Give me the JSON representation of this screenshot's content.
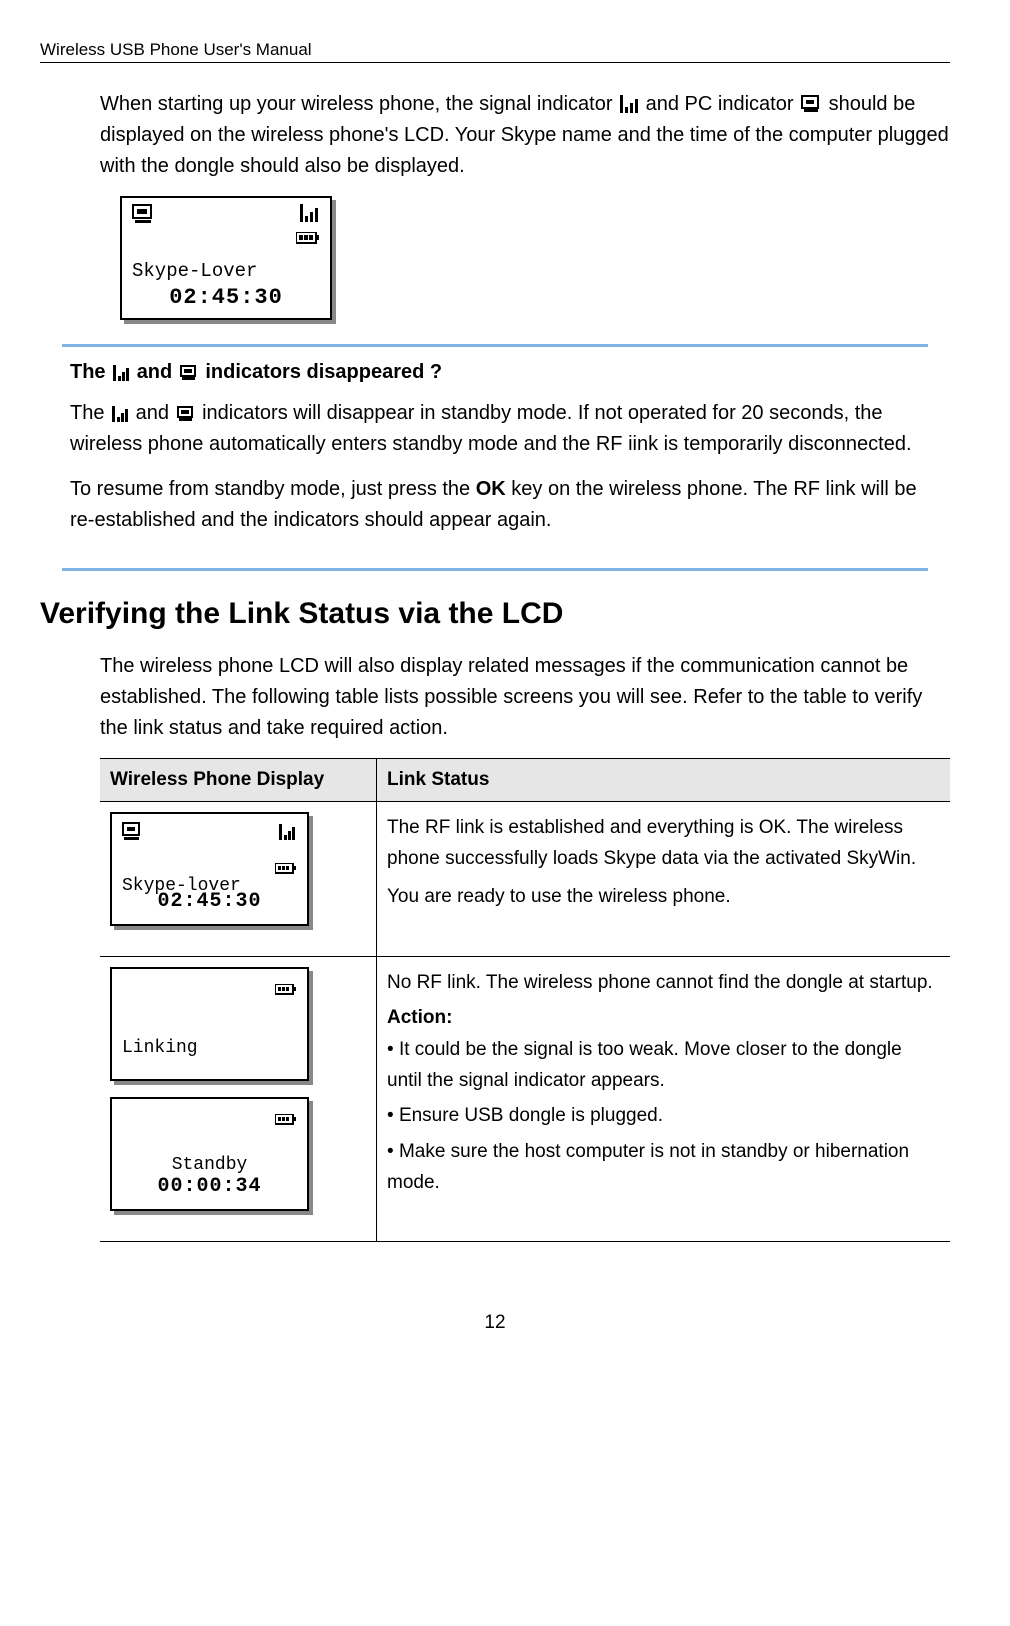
{
  "header": {
    "title": "Wireless USB Phone User's Manual"
  },
  "intro": {
    "part1": "When starting up your wireless phone, the signal indicator ",
    "part2": " and PC indicator ",
    "part3": " should be displayed on the wireless phone's LCD. Your Skype name and the time of the computer plugged with the dongle should also be displayed."
  },
  "lcd_main": {
    "name": "Skype-Lover",
    "time": "02:45:30"
  },
  "info_box": {
    "question_prefix": "The ",
    "question_mid": " and ",
    "question_suffix": " indicators disappeared ?",
    "p1_prefix": "The ",
    "p1_mid": " and ",
    "p1_suffix": " indicators will disappear in standby mode. If not operated for 20 seconds, the wireless phone automatically enters standby mode and the RF iink is temporarily disconnected.",
    "p2_a": "To resume from standby mode, just press the ",
    "p2_ok": "OK",
    "p2_b": " key on the wireless phone. The RF link will be re-established and the indicators should appear again."
  },
  "section_heading": "Verifying the Link Status via the LCD",
  "section_intro": "The wireless phone LCD will also display related messages if the communication cannot be established. The following table lists possible screens you will see. Refer to the table to verify the link status and take required action.",
  "table": {
    "h1": "Wireless Phone Display",
    "h2": "Link Status",
    "row1": {
      "lcd_name": "Skype-lover",
      "lcd_time": "02:45:30",
      "desc1": "The RF link is established and everything is OK. The wireless phone successfully loads Skype data via the activated SkyWin.",
      "desc2": "You are ready to use the wireless phone."
    },
    "row2": {
      "lcd_a_text": "Linking",
      "lcd_b_text": "Standby",
      "lcd_b_time": "00:00:34",
      "desc1": "No RF link. The wireless phone cannot find the dongle at startup.",
      "action_label": "Action:",
      "b1": "It could be the signal is too weak. Move closer to the dongle until the signal indicator appears.",
      "b2": "Ensure USB dongle is plugged.",
      "b3": "Make sure the host computer is not in standby or hibernation mode."
    }
  },
  "footer": {
    "page": "12"
  }
}
